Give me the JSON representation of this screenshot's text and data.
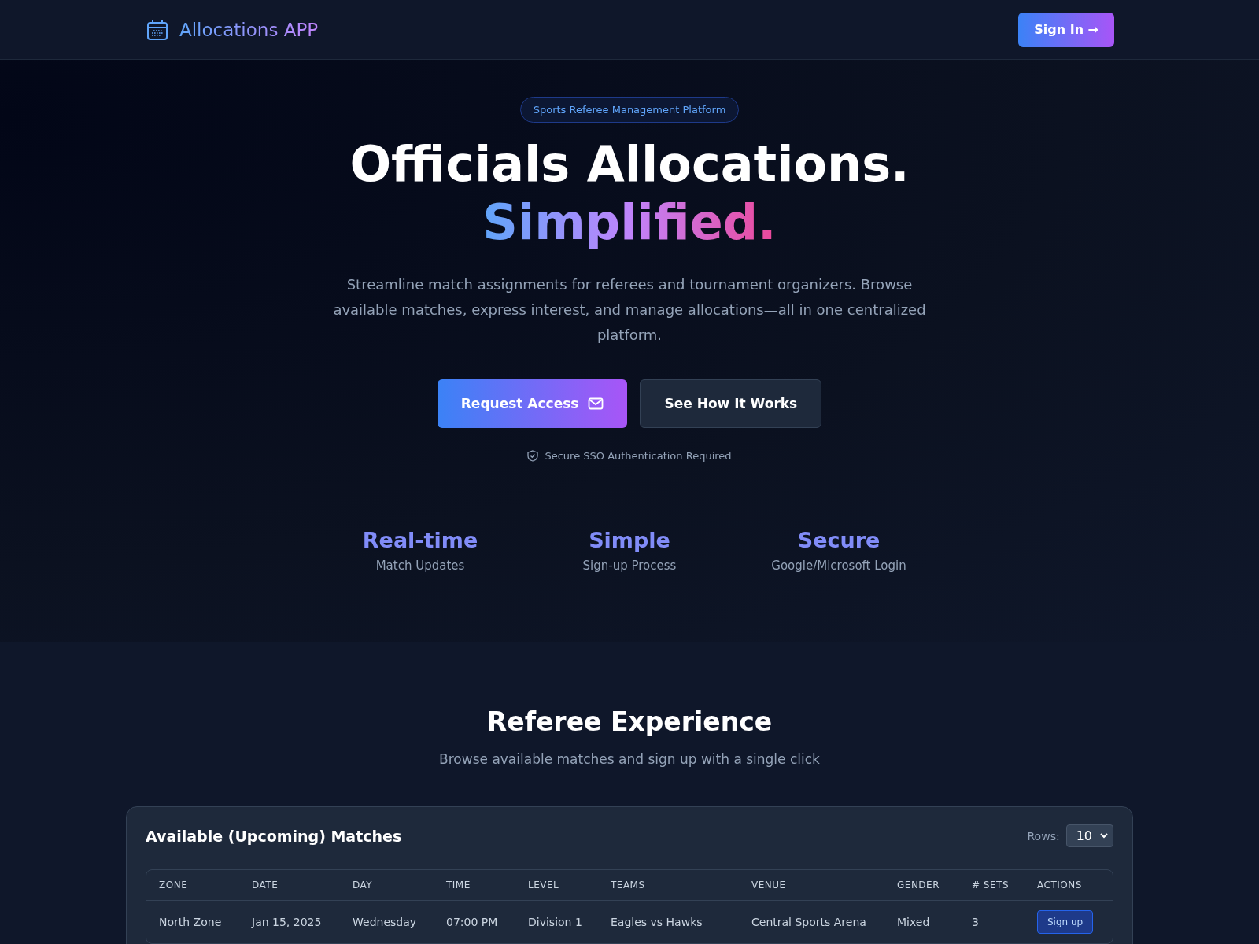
{
  "header": {
    "app_name": "Allocations APP",
    "sign_in": "Sign In →"
  },
  "hero": {
    "badge": "Sports Referee Management Platform",
    "title_line": "Officials Allocations.",
    "title_highlight": "Simplified.",
    "description": "Streamline match assignments for referees and tournament organizers. Browse available matches, express interest, and manage allocations—all in one centralized platform.",
    "primary_button": "Request Access",
    "secondary_button": "See How It Works",
    "security_note": "Secure SSO Authentication Required",
    "stats": [
      {
        "value": "Real-time",
        "label": "Match Updates"
      },
      {
        "value": "Simple",
        "label": "Sign-up Process"
      },
      {
        "value": "Secure",
        "label": "Google/Microsoft Login"
      }
    ]
  },
  "section": {
    "title": "Referee Experience",
    "subtitle": "Browse available matches and sign up with a single click"
  },
  "matches": {
    "title": "Available (Upcoming) Matches",
    "rows_label": "Rows:",
    "rows_value": "10",
    "columns": [
      "ZONE",
      "DATE",
      "DAY",
      "TIME",
      "LEVEL",
      "TEAMS",
      "VENUE",
      "GENDER",
      "# SETS",
      "ACTIONS"
    ],
    "rows": [
      {
        "cells": [
          "North Zone",
          "Jan 15, 2025",
          "Wednesday",
          "07:00 PM",
          "Division 1",
          "Eagles vs Hawks",
          "Central Sports Arena",
          "Mixed",
          "3"
        ],
        "action": "Sign up"
      }
    ]
  }
}
